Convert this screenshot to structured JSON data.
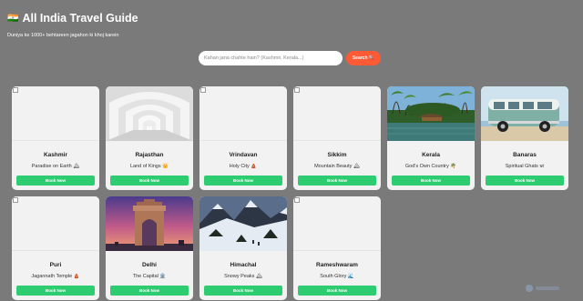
{
  "header": {
    "flag": "🇮🇳",
    "title": "All India Travel Guide",
    "subtitle": "Duniya ke 1000+ behtareen jagahon ki khoj karein"
  },
  "search": {
    "placeholder": "Kahan jana chahte hain? (Kashmir, Kerala...)",
    "button_label": "Search 🔍"
  },
  "cards": [
    {
      "name": "Kashmir",
      "tagline": "Paradise on Earth 🏔",
      "button": "Book Now",
      "image": "broken"
    },
    {
      "name": "Rajasthan",
      "tagline": "Land of Kings 👑",
      "button": "Book Now",
      "image": "arches"
    },
    {
      "name": "Vrindavan",
      "tagline": "Holy City 🛕",
      "button": "Book Now",
      "image": "broken"
    },
    {
      "name": "Sikkim",
      "tagline": "Mountain Beauty 🏔",
      "button": "Book Now",
      "image": "broken"
    },
    {
      "name": "Kerala",
      "tagline": "God's Own Country 🌴",
      "button": "Book Now",
      "image": "houseboat"
    },
    {
      "name": "Banaras",
      "tagline": "Spiritual Ghats 🕉",
      "button": "Book Now",
      "image": "van"
    },
    {
      "name": "Puri",
      "tagline": "Jagannath Temple 🛕",
      "button": "Book Now",
      "image": "broken"
    },
    {
      "name": "Delhi",
      "tagline": "The Capital 🏛️",
      "button": "Book Now",
      "image": "india-gate"
    },
    {
      "name": "Himachal",
      "tagline": "Snowy Peaks 🏔",
      "button": "Book Now",
      "image": "snow-mountains"
    },
    {
      "name": "Rameshwaram",
      "tagline": "South Glory 🌊",
      "button": "Book Now",
      "image": "broken"
    }
  ],
  "colors": {
    "background": "#7a7a7a",
    "search_button": "#ff5a36",
    "book_button": "#2ecc71"
  }
}
